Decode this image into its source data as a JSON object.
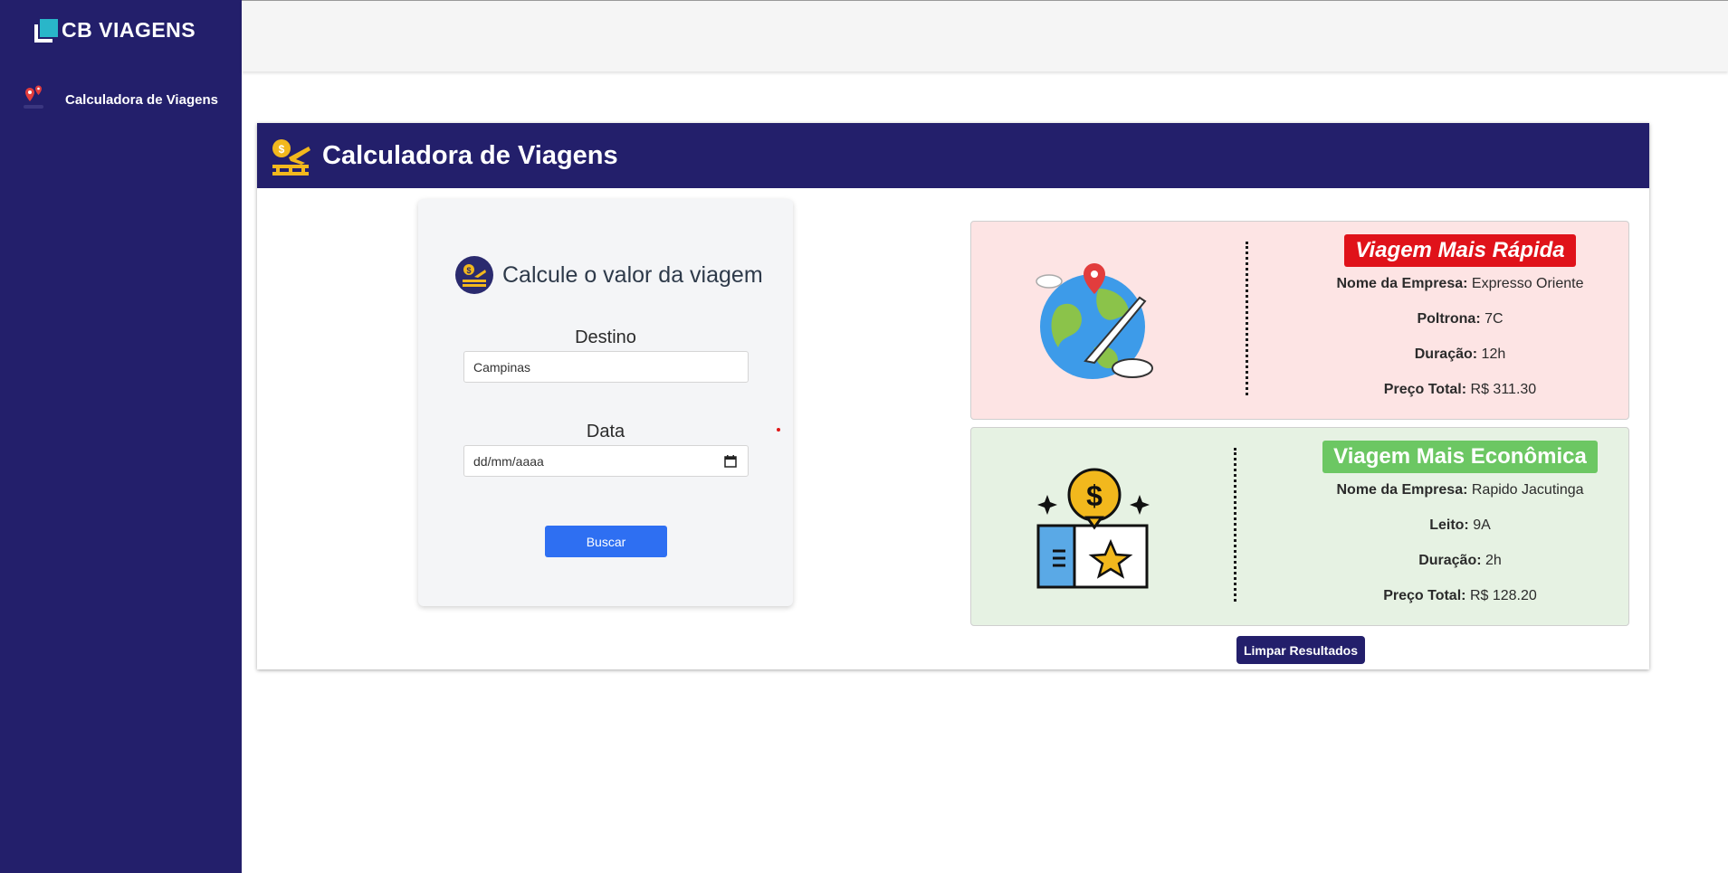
{
  "brand": {
    "name": "CB VIAGENS"
  },
  "sidebar": {
    "items": [
      {
        "label": "Calculadora de Viagens",
        "icon": "map-pins-icon"
      }
    ]
  },
  "page": {
    "title": "Calculadora de Viagens"
  },
  "form": {
    "title": "Calcule o valor da viagem",
    "destino_label": "Destino",
    "destino_value": "Campinas",
    "data_label": "Data",
    "data_placeholder": "dd/mm/aaaa",
    "buscar_label": "Buscar"
  },
  "results": {
    "fast": {
      "badge": "Viagem Mais Rápida",
      "empresa_key": "Nome da Empresa:",
      "empresa_value": "Expresso Oriente",
      "seat_key": "Poltrona:",
      "seat_value": "7C",
      "duracao_key": "Duração:",
      "duracao_value": "12h",
      "preco_key": "Preço Total:",
      "preco_value": "R$ 311.30",
      "color": "#e0121a"
    },
    "eco": {
      "badge": "Viagem Mais Econômica",
      "empresa_key": "Nome da Empresa:",
      "empresa_value": "Rapido Jacutinga",
      "seat_key": "Leito:",
      "seat_value": "9A",
      "duracao_key": "Duração:",
      "duracao_value": "2h",
      "preco_key": "Preço Total:",
      "preco_value": "R$ 128.20",
      "color": "#6cc763"
    },
    "clear_label": "Limpar Resultados"
  },
  "colors": {
    "primary": "#231f6b",
    "button_blue": "#2e6ff2",
    "fast_bg": "#fde4e4",
    "eco_bg": "#e6f2e3"
  }
}
